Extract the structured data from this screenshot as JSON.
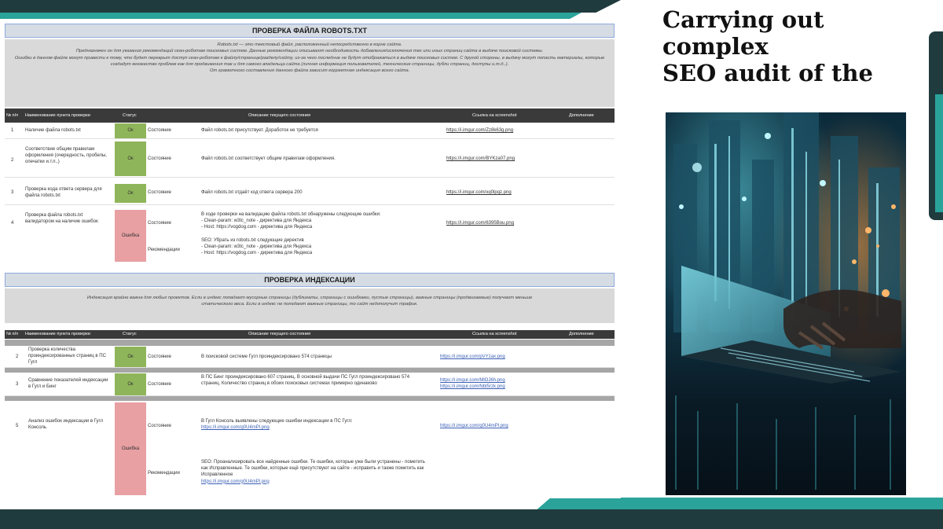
{
  "heading": [
    "Carrying out",
    "complex",
    "SEO audit of the"
  ],
  "robots": {
    "title": "ПРОВЕРКА ФАЙЛА ROBOTS.TXT",
    "intro": [
      "Robots.txt — это текстовый файл, расположенный непосредственно в корне сайта.",
      "Предназначен он для указания рекомендаций скан-роботам поисковых систем. Данные рекомендации описывают необходимость добавления/исключения тех или иных страниц сайта в выдаче поисковой системы.",
      "Ошибки в данном файле могут привести к тому, что будет перекрыт доступ скан-роботам к файлу/странице/разделу/сайту, из-за чего последние не будут отображаться в выдаче поисковых систем. С другой стороны, в выдачу могут попасть материалы, которые создадут множество проблем как для продвижения так и для самого владельца сайта (личная информация пользователей, технические страницы, дубли страниц, доступы и.т.д..).",
      "От грамотного составления данного файла зависит корректная индексация всего сайта."
    ],
    "columns": [
      "№ п/п",
      "Наименование пункта проверки",
      "Статус",
      "Описание текущего состояния",
      "Ссылка на screenshot",
      "Дополнение"
    ],
    "rows": [
      {
        "num": "1",
        "name": "Наличие файла robots.txt",
        "status": "Ок",
        "type": "Состояние",
        "desc": "Файл robots.txt присутствует. Доработок не требуется",
        "link": "https://i.imgur.com/Zz8k63g.png"
      },
      {
        "num": "2",
        "name": "Соответствие общим правилам оформления (очередность, пробелы, опечатки и.т.п..)",
        "status": "Ок",
        "type": "Состояние",
        "desc": "Файл robots.txt соответствует общим правилам оформления.",
        "link": "https://i.imgur.com/BYKza07.png"
      },
      {
        "num": "3",
        "name": "Проверка кода ответа сервера для файла robots.txt",
        "status": "Ок",
        "type": "Состояние",
        "desc": "Файл robots.txt отдаёт код ответа сервера 200",
        "link": "https://i.imgur.com/xq0lpqz.png"
      },
      {
        "num": "4",
        "name": "Проверка файла robots.txt валидатором на наличие ошибок",
        "status": "Ошибка",
        "type": "Состояние",
        "desc": [
          "В ходе проверки на валидацию файла robots.txt обнаружены следующие ошибки:",
          "- Clean-param: w3tc_note - директива для Яндекса",
          "- Host: https://vogdog.com - директива для Яндекса"
        ],
        "link": "https://i.imgur.com/6395Bou.png",
        "type2": "Рекомендации",
        "desc2": [
          "SEO: Убрать из robots.txt следующие директив",
          "- Clean-param: w3tc_note - директива для Яндекса",
          "- Host: https://vogdog.com - директива для Яндекса"
        ]
      }
    ]
  },
  "index": {
    "title": "ПРОВЕРКА ИНДЕКСАЦИИ",
    "intro": [
      "Индексация крайне важна для любых проектов. Если в индекс попадают мусорные страницы (дубликаты, страницы с ошибками, пустые страницы), важные страницы (продвигаемые) получают меньше",
      "статического веса. Если в индекс не попадают важные страницы, то сайт недополучит трафик."
    ],
    "columns": [
      "№ п/п",
      "Наименование пункта проверки",
      "Статус",
      "Описание текущего состояния",
      "Ссылка на screenshot",
      "Дополнение"
    ],
    "rows": [
      {
        "num": "2",
        "name": "Проверка количества проиндексированных страниц в ПС Гугл",
        "status": "Ок",
        "type": "Состояние",
        "desc": "В поисковой системе Гугл проиндексировано 574 страницы",
        "link": "https://i.imgur.com/pVYzax.png"
      },
      {
        "num": "3",
        "name": "Сравнение показателей индексации в Гугл и Бинг",
        "status": "Ок",
        "type": "Состояние",
        "desc": "В ПС Бинг проиндексировано 607 страниц. В основной выдачи ПС Гугл проиндексировано 574 страниц. Количество страниц в обоих поисковых системах примерно одинаково",
        "link": "https://i.imgur.com/MlOJ6h.png",
        "link2": "https://i.imgur.com/Nbt5rzk.png"
      },
      {
        "num": "5",
        "name": "Анализ ошибок индексации в Гугл Консоль",
        "status": "Ошибка",
        "type": "Состояние",
        "desc": "В Гугл Консоль выявлены следующие ошибки индексации в ПС Гугл:",
        "desc_link": "https://i.imgur.com/g0U4mPl.png",
        "link": "https://i.imgur.com/g0U4mPl.png",
        "type2": "Рекомендации",
        "desc2": "SEO: Проанализировать все найденные ошибки. Те ошибки, которые уже были устранены - пометить как Исправленные. Те ошибки, которые ещё присутствуют на сайте - исправить и также пометить как Исправленное",
        "desc2_link": "https://i.imgur.com/g0U4mPl.png"
      }
    ]
  },
  "colors": {
    "ok": "#8fb55a",
    "error": "#e8a0a3",
    "header": "#3a3a3a",
    "teal": "#2aa39a",
    "dark": "#1f3b3e"
  }
}
